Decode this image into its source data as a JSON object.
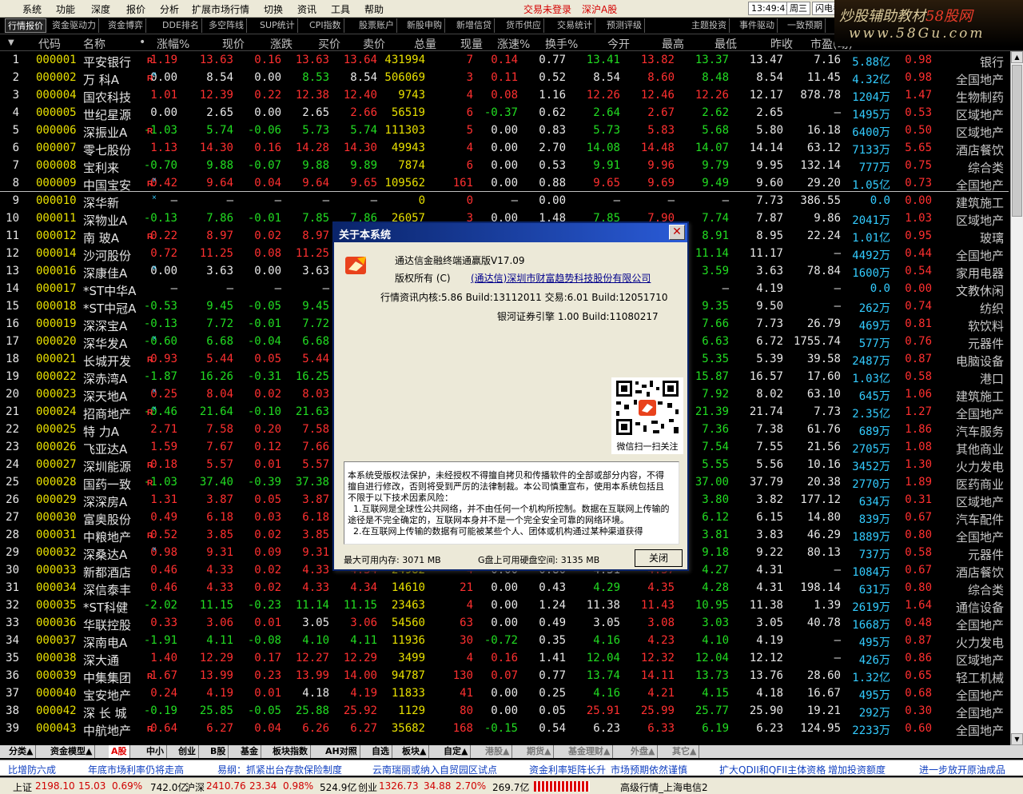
{
  "menu": {
    "items": [
      "系统",
      "功能",
      "深度",
      "报价",
      "分析",
      "扩展市场行情",
      "切换",
      "资讯",
      "工具",
      "帮助"
    ],
    "trade_status": "交易未登录",
    "market": "深沪A股",
    "time": "13:49:41",
    "weekday": "周三",
    "flash_label": "闪电手"
  },
  "logo": {
    "line1_a": "炒股辅助教材",
    "line1_b": "58股网",
    "line2": "www.58Gu.com"
  },
  "tabs": [
    "行情报价",
    "资金驱动力",
    "资金博弈",
    "DDE排名",
    "多空阵线",
    "SUP统计",
    "CPI指数",
    "股票账户",
    "新股申购",
    "新增信贷",
    "货币供应",
    "交易统计",
    "预测评级",
    "主题投资",
    "事件驱动",
    "一致预期"
  ],
  "columns": [
    "代码",
    "名称",
    "•",
    "涨幅%",
    "现价",
    "涨跌",
    "买价",
    "卖价",
    "总量",
    "现量",
    "涨速%",
    "换手%",
    "今开",
    "最高",
    "最低",
    "昨收",
    "市盈(动)",
    "",
    "",
    ""
  ],
  "rows": [
    [
      "1",
      "000001",
      "平安银行",
      "R",
      "",
      "1.19",
      "13.63",
      "0.16",
      "13.63",
      "13.64",
      "431994",
      "7",
      "0.14",
      "0.77",
      "13.41",
      "13.82",
      "13.37",
      "13.47",
      "7.16",
      "5.88亿",
      "0.98",
      "银行"
    ],
    [
      "2",
      "000002",
      "万  科A",
      "R",
      "×",
      "0.00",
      "8.54",
      "0.00",
      "8.53",
      "8.54",
      "506069",
      "3",
      "0.11",
      "0.52",
      "8.54",
      "8.60",
      "8.48",
      "8.54",
      "11.45",
      "4.32亿",
      "0.98",
      "全国地产"
    ],
    [
      "3",
      "000004",
      "国农科技",
      "",
      "",
      "1.01",
      "12.39",
      "0.22",
      "12.38",
      "12.40",
      "9743",
      "4",
      "0.08",
      "1.16",
      "12.26",
      "12.46",
      "12.26",
      "12.17",
      "878.78",
      "1204万",
      "1.47",
      "生物制药"
    ],
    [
      "4",
      "000005",
      "世纪星源",
      "",
      "",
      "0.00",
      "2.65",
      "0.00",
      "2.65",
      "2.66",
      "56519",
      "6",
      "-0.37",
      "0.62",
      "2.64",
      "2.67",
      "2.62",
      "2.65",
      "—",
      "1495万",
      "0.53",
      "区域地产"
    ],
    [
      "5",
      "000006",
      "深振业A",
      "R",
      "",
      "-1.03",
      "5.74",
      "-0.06",
      "5.73",
      "5.74",
      "111303",
      "5",
      "0.00",
      "0.83",
      "5.73",
      "5.83",
      "5.68",
      "5.80",
      "16.18",
      "6400万",
      "0.50",
      "区域地产"
    ],
    [
      "6",
      "000007",
      "零七股份",
      "",
      "",
      "1.13",
      "14.30",
      "0.16",
      "14.28",
      "14.30",
      "49943",
      "4",
      "0.00",
      "2.70",
      "14.08",
      "14.48",
      "14.07",
      "14.14",
      "63.12",
      "7133万",
      "5.65",
      "酒店餐饮"
    ],
    [
      "7",
      "000008",
      "宝利来",
      "",
      "",
      "-0.70",
      "9.88",
      "-0.07",
      "9.88",
      "9.89",
      "7874",
      "6",
      "0.00",
      "0.53",
      "9.91",
      "9.96",
      "9.79",
      "9.95",
      "132.14",
      "777万",
      "0.75",
      "综合类"
    ],
    [
      "8",
      "000009",
      "中国宝安",
      "R",
      "×",
      "0.42",
      "9.64",
      "0.04",
      "9.64",
      "9.65",
      "109562",
      "161",
      "0.00",
      "0.88",
      "9.65",
      "9.69",
      "9.49",
      "9.60",
      "29.20",
      "1.05亿",
      "0.73",
      "全国地产"
    ],
    [
      "9",
      "000010",
      "深华新",
      "",
      "×",
      "—",
      "—",
      "—",
      "—",
      "—",
      "0",
      "0",
      "—",
      "0.00",
      "—",
      "—",
      "—",
      "7.73",
      "386.55",
      "0.0",
      "0.00",
      "建筑施工"
    ],
    [
      "10",
      "000011",
      "深物业A",
      "",
      "",
      "-0.13",
      "7.86",
      "-0.01",
      "7.85",
      "7.86",
      "26057",
      "3",
      "0.00",
      "1.48",
      "7.85",
      "7.90",
      "7.74",
      "7.87",
      "9.86",
      "2041万",
      "1.03",
      "区域地产"
    ],
    [
      "11",
      "000012",
      "南  玻A",
      "R",
      "",
      "0.22",
      "8.97",
      "0.02",
      "8.97",
      "8.98",
      "22512",
      "3",
      "0.00",
      "0.42",
      "8.96",
      "9.02",
      "8.91",
      "8.95",
      "22.24",
      "1.01亿",
      "0.95",
      "玻璃"
    ],
    [
      "12",
      "000014",
      "沙河股份",
      "",
      "",
      "0.72",
      "11.25",
      "0.08",
      "11.25",
      "11.26",
      "3992",
      "2",
      "0.00",
      "0.19",
      "11.14",
      "11.30",
      "11.14",
      "11.17",
      "—",
      "4492万",
      "0.44",
      "全国地产"
    ],
    [
      "13",
      "000016",
      "深康佳A",
      "",
      "×",
      "0.00",
      "3.63",
      "0.00",
      "3.63",
      "3.64",
      "43934",
      "3",
      "0.00",
      "0.73",
      "3.63",
      "3.66",
      "3.59",
      "3.63",
      "78.84",
      "1600万",
      "0.54",
      "家用电器"
    ],
    [
      "14",
      "000017",
      "*ST中华A",
      "",
      "",
      "—",
      "—",
      "—",
      "—",
      "—",
      "0",
      "0",
      "—",
      "0.00",
      "—",
      "—",
      "—",
      "4.19",
      "—",
      "0.0",
      "0.00",
      "文教休闲"
    ],
    [
      "15",
      "000018",
      "*ST中冠A",
      "",
      "",
      "-0.53",
      "9.45",
      "-0.05",
      "9.45",
      "9.46",
      "2823",
      "2",
      "0.00",
      "0.19",
      "9.49",
      "9.52",
      "9.35",
      "9.50",
      "—",
      "262万",
      "0.74",
      "纺织"
    ],
    [
      "16",
      "000019",
      "深深宝A",
      "",
      "",
      "-0.13",
      "7.72",
      "-0.01",
      "7.72",
      "7.73",
      "6043",
      "4",
      "0.00",
      "0.24",
      "7.73",
      "7.80",
      "7.66",
      "7.73",
      "26.79",
      "469万",
      "0.81",
      "软饮料"
    ],
    [
      "17",
      "000020",
      "深华发A",
      "",
      "×",
      "-0.60",
      "6.68",
      "-0.04",
      "6.68",
      "6.69",
      "8634",
      "3",
      "0.00",
      "0.48",
      "6.71",
      "6.74",
      "6.63",
      "6.72",
      "1755.74",
      "577万",
      "0.76",
      "元器件"
    ],
    [
      "18",
      "000021",
      "长城开发",
      "R",
      "",
      "0.93",
      "5.44",
      "0.05",
      "5.44",
      "5.45",
      "44858",
      "4",
      "0.00",
      "0.34",
      "5.39",
      "5.49",
      "5.35",
      "5.39",
      "39.58",
      "2487万",
      "0.87",
      "电脑设备"
    ],
    [
      "19",
      "000022",
      "深赤湾A",
      "",
      "",
      "-1.87",
      "16.26",
      "-0.31",
      "16.25",
      "16.26",
      "6414",
      "2",
      "0.00",
      "0.14",
      "16.50",
      "16.52",
      "15.87",
      "16.57",
      "17.60",
      "1.03亿",
      "0.58",
      "港口"
    ],
    [
      "20",
      "000023",
      "深天地A",
      "",
      "×",
      "0.25",
      "8.04",
      "0.02",
      "8.03",
      "8.04",
      "8012",
      "2",
      "0.00",
      "0.58",
      "7.97",
      "8.10",
      "7.92",
      "8.02",
      "63.10",
      "645万",
      "1.06",
      "建筑施工"
    ],
    [
      "21",
      "000024",
      "招商地产",
      "R",
      "×",
      "-0.46",
      "21.64",
      "-0.10",
      "21.63",
      "21.64",
      "10934",
      "4",
      "0.00",
      "0.32",
      "21.73",
      "21.80",
      "21.39",
      "21.74",
      "7.73",
      "2.35亿",
      "1.27",
      "全国地产"
    ],
    [
      "22",
      "000025",
      "特  力A",
      "",
      "",
      "2.71",
      "7.58",
      "0.20",
      "7.58",
      "7.59",
      "9161",
      "3",
      "0.00",
      "0.91",
      "7.39",
      "7.62",
      "7.36",
      "7.38",
      "61.76",
      "689万",
      "1.86",
      "汽车服务"
    ],
    [
      "23",
      "000026",
      "飞亚达A",
      "",
      "",
      "1.59",
      "7.67",
      "0.12",
      "7.66",
      "7.67",
      "35226",
      "4",
      "0.00",
      "1.40",
      "7.56",
      "7.70",
      "7.54",
      "7.55",
      "21.56",
      "2705万",
      "1.08",
      "其他商业"
    ],
    [
      "24",
      "000027",
      "深圳能源",
      "R",
      "",
      "0.18",
      "5.57",
      "0.01",
      "5.57",
      "5.58",
      "62015",
      "4",
      "0.00",
      "0.23",
      "5.57",
      "5.61",
      "5.55",
      "5.56",
      "10.16",
      "3452万",
      "1.30",
      "火力发电"
    ],
    [
      "25",
      "000028",
      "国药一致",
      "R",
      "",
      "-1.03",
      "37.40",
      "-0.39",
      "37.38",
      "37.40",
      "7290",
      "3",
      "0.00",
      "0.51",
      "37.71",
      "37.76",
      "37.00",
      "37.79",
      "20.38",
      "2770万",
      "1.89",
      "医药商业"
    ],
    [
      "26",
      "000029",
      "深深房A",
      "",
      "",
      "1.31",
      "3.87",
      "0.05",
      "3.87",
      "3.88",
      "16384",
      "3",
      "0.00",
      "0.18",
      "3.82",
      "3.89",
      "3.80",
      "3.82",
      "177.12",
      "634万",
      "0.31",
      "区域地产"
    ],
    [
      "27",
      "000030",
      "富奥股份",
      "",
      "",
      "0.49",
      "6.18",
      "0.03",
      "6.18",
      "6.19",
      "13592",
      "3",
      "0.00",
      "0.14",
      "6.15",
      "6.22",
      "6.12",
      "6.15",
      "14.80",
      "839万",
      "0.67",
      "汽车配件"
    ],
    [
      "28",
      "000031",
      "中粮地产",
      "R",
      "",
      "0.52",
      "3.85",
      "0.02",
      "3.85",
      "3.86",
      "48964",
      "4",
      "0.00",
      "0.27",
      "3.83",
      "3.87",
      "3.81",
      "3.83",
      "46.29",
      "1889万",
      "0.80",
      "全国地产"
    ],
    [
      "29",
      "000032",
      "深桑达A",
      "",
      "×",
      "0.98",
      "9.31",
      "0.09",
      "9.31",
      "9.32",
      "7919",
      "3",
      "0.00",
      "0.36",
      "9.22",
      "9.38",
      "9.18",
      "9.22",
      "80.13",
      "737万",
      "0.58",
      "元器件"
    ],
    [
      "30",
      "000033",
      "新都酒店",
      "",
      "",
      "0.46",
      "4.33",
      "0.02",
      "4.33",
      "4.34",
      "24982",
      "4",
      "0.00",
      "0.80",
      "4.31",
      "4.37",
      "4.27",
      "4.31",
      "—",
      "1084万",
      "0.67",
      "酒店餐饮"
    ],
    [
      "31",
      "000034",
      "深信泰丰",
      "",
      "",
      "0.46",
      "4.33",
      "0.02",
      "4.33",
      "4.34",
      "14610",
      "21",
      "0.00",
      "0.43",
      "4.29",
      "4.35",
      "4.28",
      "4.31",
      "198.14",
      "631万",
      "0.80",
      "综合类"
    ],
    [
      "32",
      "000035",
      "*ST科健",
      "",
      "",
      "-2.02",
      "11.15",
      "-0.23",
      "11.14",
      "11.15",
      "23463",
      "4",
      "0.00",
      "1.24",
      "11.38",
      "11.43",
      "10.95",
      "11.38",
      "1.39",
      "2619万",
      "1.64",
      "通信设备"
    ],
    [
      "33",
      "000036",
      "华联控股",
      "",
      "",
      "0.33",
      "3.06",
      "0.01",
      "3.05",
      "3.06",
      "54560",
      "63",
      "0.00",
      "0.49",
      "3.05",
      "3.08",
      "3.03",
      "3.05",
      "40.78",
      "1668万",
      "0.48",
      "全国地产"
    ],
    [
      "34",
      "000037",
      "深南电A",
      "",
      "",
      "-1.91",
      "4.11",
      "-0.08",
      "4.10",
      "4.11",
      "11936",
      "30",
      "-0.72",
      "0.35",
      "4.16",
      "4.23",
      "4.10",
      "4.19",
      "—",
      "495万",
      "0.87",
      "火力发电"
    ],
    [
      "35",
      "000038",
      "深大通",
      "",
      "",
      "1.40",
      "12.29",
      "0.17",
      "12.27",
      "12.29",
      "3499",
      "4",
      "0.16",
      "1.41",
      "12.04",
      "12.32",
      "12.04",
      "12.12",
      "—",
      "426万",
      "0.86",
      "区域地产"
    ],
    [
      "36",
      "000039",
      "中集集团",
      "R",
      "",
      "1.67",
      "13.99",
      "0.23",
      "13.99",
      "14.00",
      "94787",
      "130",
      "0.07",
      "0.77",
      "13.74",
      "14.11",
      "13.73",
      "13.76",
      "28.60",
      "1.32亿",
      "0.65",
      "轻工机械"
    ],
    [
      "37",
      "000040",
      "宝安地产",
      "",
      "",
      "0.24",
      "4.19",
      "0.01",
      "4.18",
      "4.19",
      "11833",
      "41",
      "0.00",
      "0.25",
      "4.16",
      "4.21",
      "4.15",
      "4.18",
      "16.67",
      "495万",
      "0.68",
      "全国地产"
    ],
    [
      "38",
      "000042",
      "深 长 城",
      "",
      "",
      "-0.19",
      "25.85",
      "-0.05",
      "25.88",
      "25.92",
      "1129",
      "80",
      "0.00",
      "0.05",
      "25.91",
      "25.99",
      "25.77",
      "25.90",
      "19.21",
      "292万",
      "0.30",
      "全国地产"
    ],
    [
      "39",
      "000043",
      "中航地产",
      "R",
      "",
      "0.64",
      "6.27",
      "0.04",
      "6.26",
      "6.27",
      "35682",
      "168",
      "-0.15",
      "0.54",
      "6.23",
      "6.33",
      "6.19",
      "6.23",
      "124.95",
      "2233万",
      "0.60",
      "全国地产"
    ]
  ],
  "sheet_tabs": [
    "分类▲",
    "资金模型▲",
    "A股",
    "中小",
    "创业",
    "B股",
    "基金",
    "板块指数",
    "AH对照",
    "自选",
    "板块▲",
    "自定▲",
    "港股▲",
    "期货▲",
    "基金理财▲",
    "外盘▲",
    "其它▲"
  ],
  "news": [
    "比增防六成",
    "年底市场利率仍将走高",
    "易纲：抓紧出台存款保险制度",
    "云南瑞丽或纳入自贸园区试点",
    "资金利率矩阵长升",
    "市场预期依然谨慎",
    "扩大QDII和QFII主体资格",
    "增加投资额度",
    "进一步放开原油成品"
  ],
  "status": {
    "sh_label": "上证",
    "sh_index": "2198.10",
    "sh_chg": "15.03",
    "sh_pct": "0.69%",
    "sh_amt": "742.0亿",
    "hs_label": "沪深",
    "hs_index": "2410.76",
    "hs_chg": "23.34",
    "hs_pct": "0.98%",
    "hs_amt": "524.9亿",
    "cy_label": "创业",
    "cy_index": "1326.73",
    "cy_chg": "34.88",
    "cy_pct": "2.70%",
    "cy_amt": "269.7亿",
    "server": "高级行情_上海电信2"
  },
  "dialog": {
    "title": "关于本系统",
    "product": "通达信金融终端通赢版V17.09",
    "copyright_label": "版权所有 (C)",
    "company": "(通达信)深圳市财富趋势科技股份有限公司",
    "core": "行情资讯内核:5.86 Build:13112011  交易:6.01 Build:12051710",
    "engine": "银河证券引擎 1.00 Build:11080217",
    "qr_caption": "微信扫一扫关注",
    "notice": "本系统受版权法保护，未经授权不得擅自拷贝和传播软件的全部或部分内容，不得擅自进行修改，否则将受到严厉的法律制裁。本公司慎重宣布，使用本系统包括且不限于以下技术因素风险：\n  1.互联网是全球性公共网络，并不由任何一个机构所控制。数据在互联网上传输的途径是不完全确定的，互联网本身并不是一个完全安全可靠的网络环境。\n  2.在互联网上传输的数据有可能被某些个人、团体或机构通过某种渠道获得",
    "mem": "最大可用内存: 3071 MB",
    "disk": "G盘上可用硬盘空间: 3135 MB",
    "ok": "关闭"
  }
}
